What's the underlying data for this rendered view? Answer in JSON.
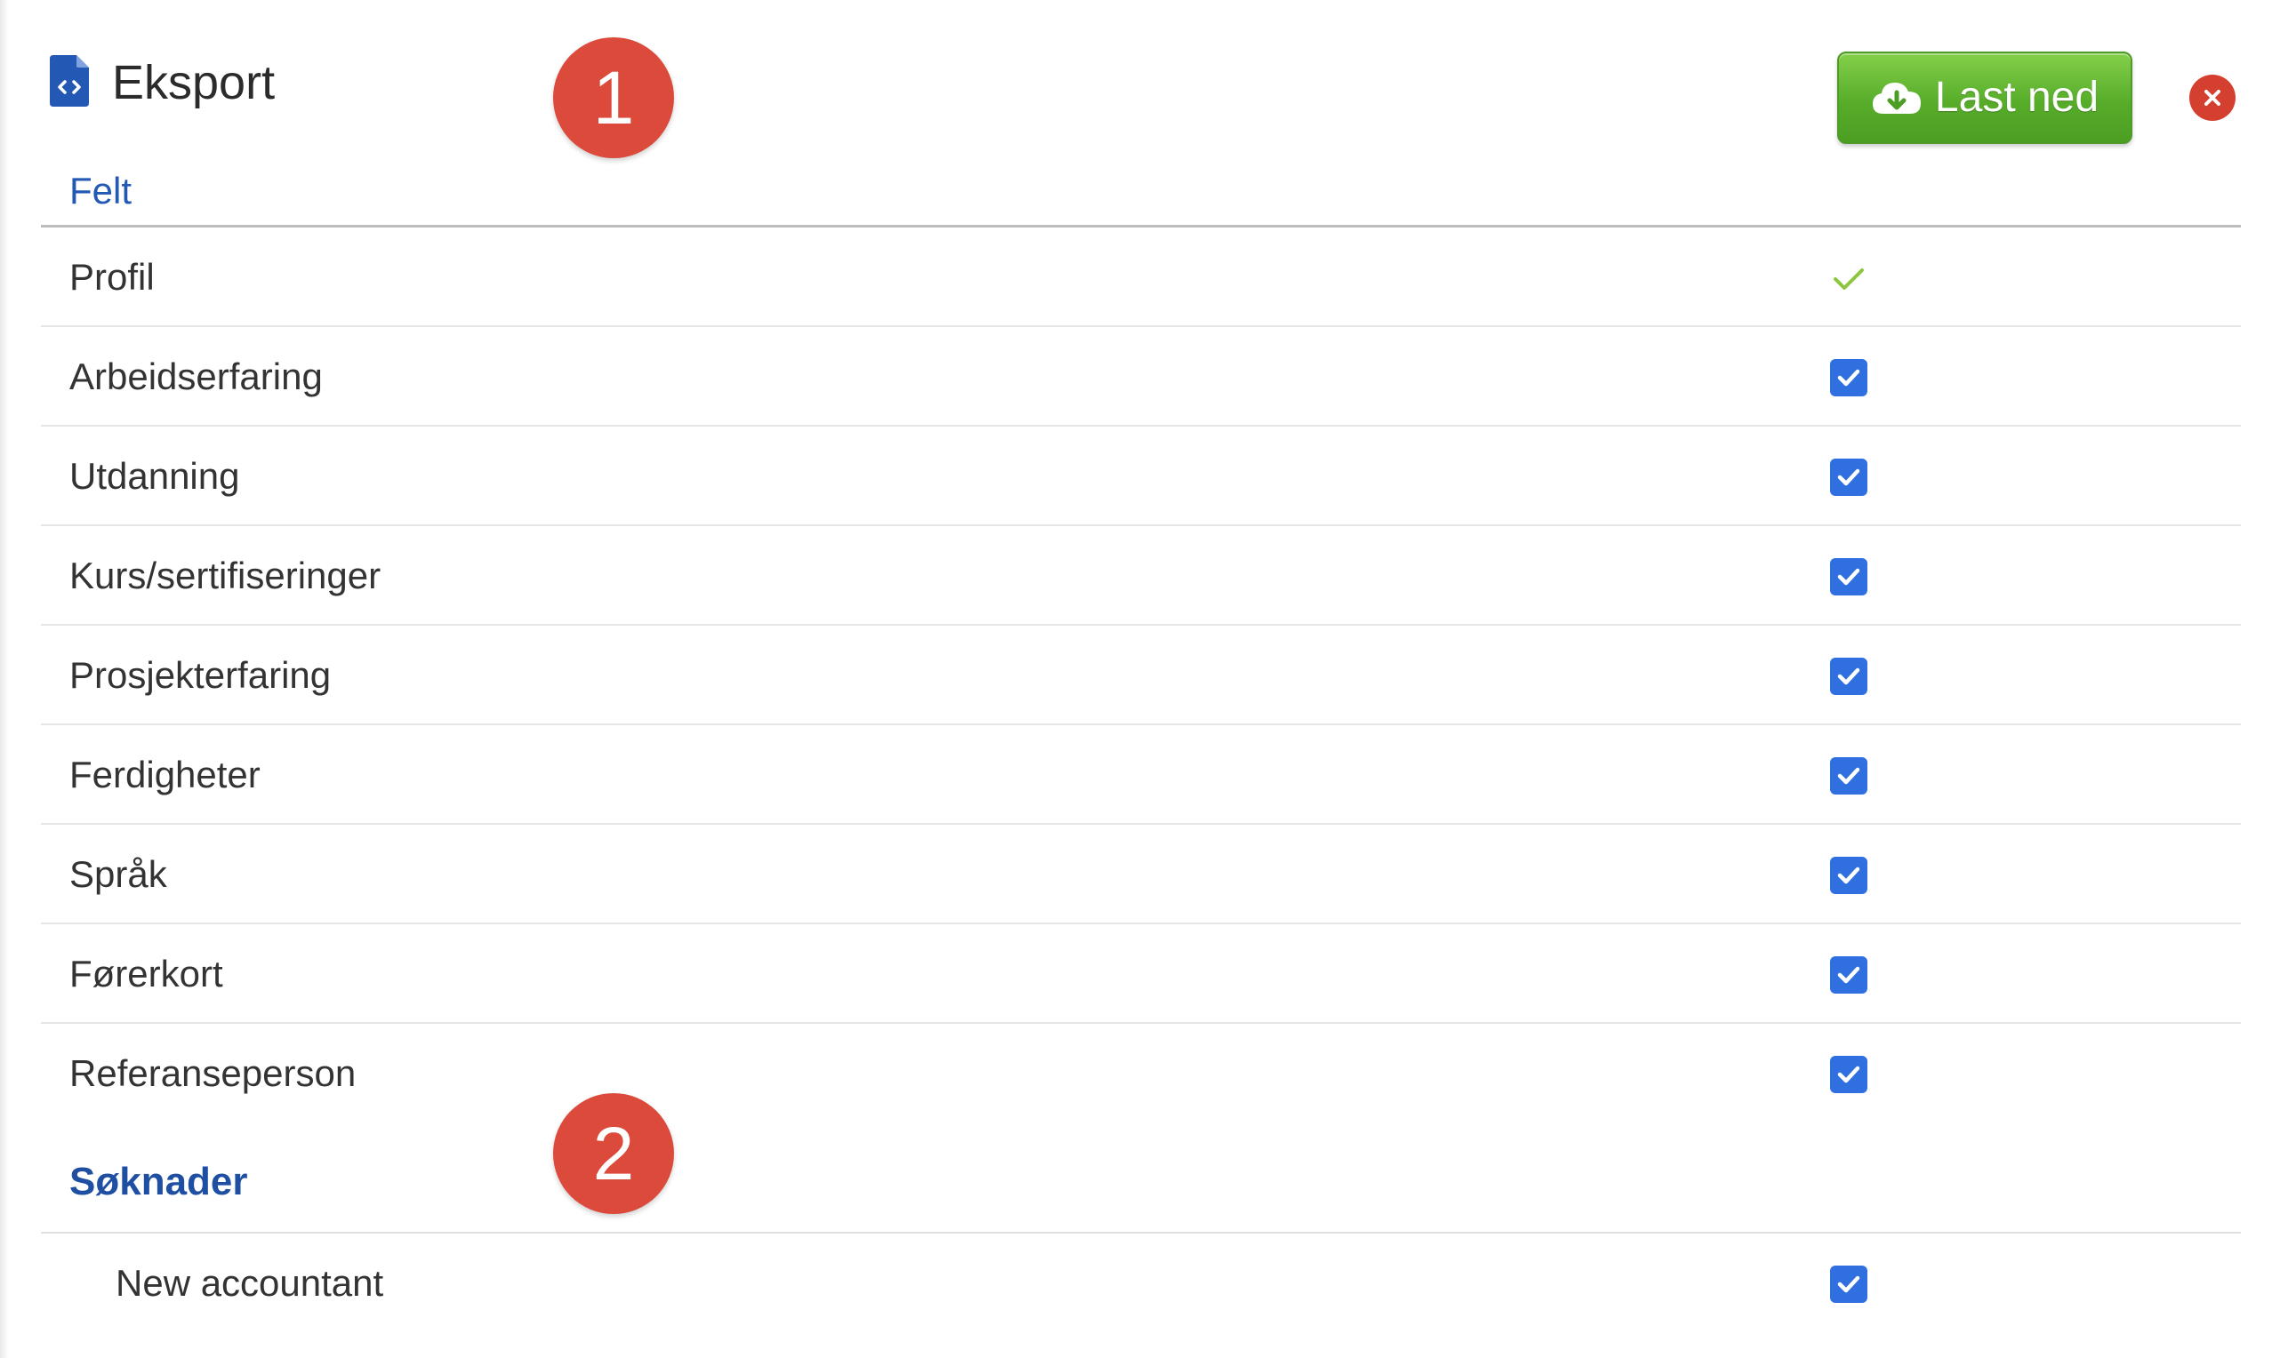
{
  "header": {
    "title": "Eksport",
    "title_icon": "file-code-icon",
    "download_label": "Last ned",
    "download_icon": "cloud-download-icon",
    "close_icon": "close-icon"
  },
  "markers": [
    "1",
    "2"
  ],
  "table": {
    "column_header": "Felt",
    "rows": [
      {
        "label": "Profil",
        "control": "static-check"
      },
      {
        "label": "Arbeidserfaring",
        "checked": true
      },
      {
        "label": "Utdanning",
        "checked": true
      },
      {
        "label": "Kurs/sertifiseringer",
        "checked": true
      },
      {
        "label": "Prosjekterfaring",
        "checked": true
      },
      {
        "label": "Ferdigheter",
        "checked": true
      },
      {
        "label": "Språk",
        "checked": true
      },
      {
        "label": "Førerkort",
        "checked": true
      },
      {
        "label": "Referanseperson",
        "checked": true
      }
    ]
  },
  "applications": {
    "title": "Søknader",
    "items": [
      {
        "label": "New accountant",
        "checked": true
      }
    ]
  },
  "colors": {
    "accent_blue": "#2458b5",
    "checkbox_blue": "#2f6fe0",
    "download_green": "#57ad2a",
    "close_red": "#d43f2f",
    "marker_red": "#dc4a3b",
    "check_green": "#8cc63f"
  }
}
